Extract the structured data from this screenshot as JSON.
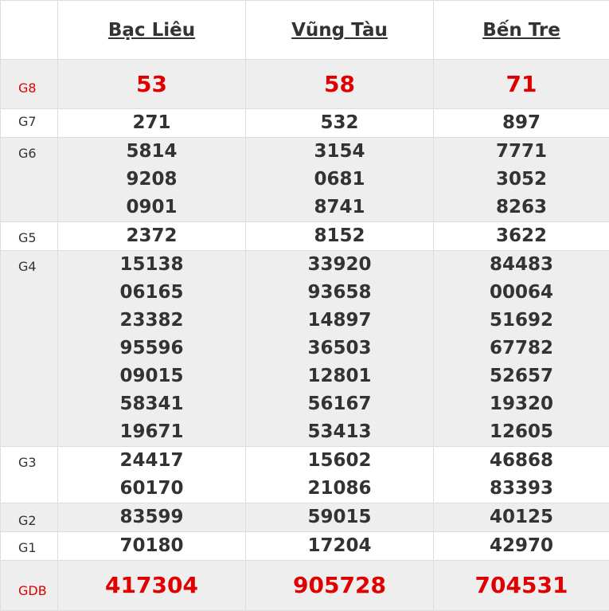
{
  "provinces": [
    "Bạc Liêu",
    "Vũng Tàu",
    "Bến Tre"
  ],
  "prizes": [
    {
      "label": "G8",
      "values": [
        [
          "53"
        ],
        [
          "58"
        ],
        [
          "71"
        ]
      ]
    },
    {
      "label": "G7",
      "values": [
        [
          "271"
        ],
        [
          "532"
        ],
        [
          "897"
        ]
      ]
    },
    {
      "label": "G6",
      "values": [
        [
          "5814",
          "9208",
          "0901"
        ],
        [
          "3154",
          "0681",
          "8741"
        ],
        [
          "7771",
          "3052",
          "8263"
        ]
      ]
    },
    {
      "label": "G5",
      "values": [
        [
          "2372"
        ],
        [
          "8152"
        ],
        [
          "3622"
        ]
      ]
    },
    {
      "label": "G4",
      "values": [
        [
          "15138",
          "06165",
          "23382",
          "95596",
          "09015",
          "58341",
          "19671"
        ],
        [
          "33920",
          "93658",
          "14897",
          "36503",
          "12801",
          "56167",
          "53413"
        ],
        [
          "84483",
          "00064",
          "51692",
          "67782",
          "52657",
          "19320",
          "12605"
        ]
      ]
    },
    {
      "label": "G3",
      "values": [
        [
          "24417",
          "60170"
        ],
        [
          "15602",
          "21086"
        ],
        [
          "46868",
          "83393"
        ]
      ]
    },
    {
      "label": "G2",
      "values": [
        [
          "83599"
        ],
        [
          "59015"
        ],
        [
          "40125"
        ]
      ]
    },
    {
      "label": "G1",
      "values": [
        [
          "70180"
        ],
        [
          "17204"
        ],
        [
          "42970"
        ]
      ]
    },
    {
      "label": "GDB",
      "values": [
        [
          "417304"
        ],
        [
          "905728"
        ],
        [
          "704531"
        ]
      ]
    }
  ],
  "colors": {
    "highlight": "#e00000",
    "text": "#333333",
    "shaded_row": "#eeeeee",
    "border": "#dddddd"
  }
}
